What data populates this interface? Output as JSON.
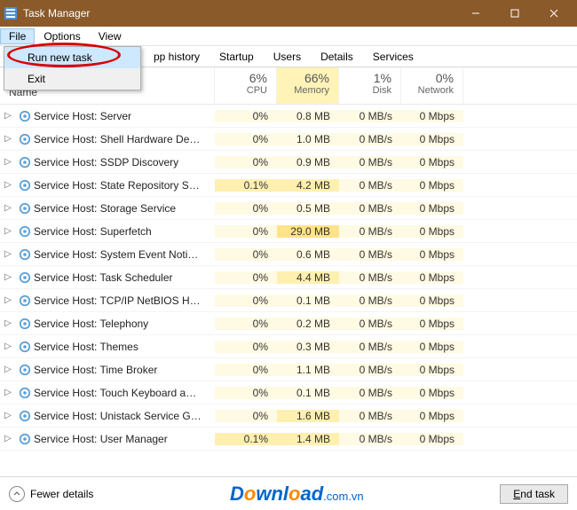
{
  "window": {
    "title": "Task Manager"
  },
  "menubar": {
    "file": "File",
    "options": "Options",
    "view": "View"
  },
  "file_menu": {
    "run_new_task": "Run new task",
    "exit": "Exit"
  },
  "tabs": {
    "app_history": "pp history",
    "startup": "Startup",
    "users": "Users",
    "details": "Details",
    "services": "Services"
  },
  "columns": {
    "name": "Name",
    "cpu_pct": "6%",
    "cpu_label": "CPU",
    "mem_pct": "66%",
    "mem_label": "Memory",
    "disk_pct": "1%",
    "disk_label": "Disk",
    "net_pct": "0%",
    "net_label": "Network"
  },
  "processes": [
    {
      "name": "Service Host: Server",
      "cpu": "0%",
      "mem": "0.8 MB",
      "disk": "0 MB/s",
      "net": "0 Mbps",
      "mem_tint": 1
    },
    {
      "name": "Service Host: Shell Hardware De…",
      "cpu": "0%",
      "mem": "1.0 MB",
      "disk": "0 MB/s",
      "net": "0 Mbps",
      "mem_tint": 1
    },
    {
      "name": "Service Host: SSDP Discovery",
      "cpu": "0%",
      "mem": "0.9 MB",
      "disk": "0 MB/s",
      "net": "0 Mbps",
      "mem_tint": 1
    },
    {
      "name": "Service Host: State Repository S…",
      "cpu": "0.1%",
      "mem": "4.2 MB",
      "disk": "0 MB/s",
      "net": "0 Mbps",
      "mem_tint": 2,
      "cpu_tint": 2
    },
    {
      "name": "Service Host: Storage Service",
      "cpu": "0%",
      "mem": "0.5 MB",
      "disk": "0 MB/s",
      "net": "0 Mbps",
      "mem_tint": 1
    },
    {
      "name": "Service Host: Superfetch",
      "cpu": "0%",
      "mem": "29.0 MB",
      "disk": "0 MB/s",
      "net": "0 Mbps",
      "mem_tint": 3
    },
    {
      "name": "Service Host: System Event Noti…",
      "cpu": "0%",
      "mem": "0.6 MB",
      "disk": "0 MB/s",
      "net": "0 Mbps",
      "mem_tint": 1
    },
    {
      "name": "Service Host: Task Scheduler",
      "cpu": "0%",
      "mem": "4.4 MB",
      "disk": "0 MB/s",
      "net": "0 Mbps",
      "mem_tint": 2
    },
    {
      "name": "Service Host: TCP/IP NetBIOS H…",
      "cpu": "0%",
      "mem": "0.1 MB",
      "disk": "0 MB/s",
      "net": "0 Mbps",
      "mem_tint": 1
    },
    {
      "name": "Service Host: Telephony",
      "cpu": "0%",
      "mem": "0.2 MB",
      "disk": "0 MB/s",
      "net": "0 Mbps",
      "mem_tint": 1
    },
    {
      "name": "Service Host: Themes",
      "cpu": "0%",
      "mem": "0.3 MB",
      "disk": "0 MB/s",
      "net": "0 Mbps",
      "mem_tint": 1
    },
    {
      "name": "Service Host: Time Broker",
      "cpu": "0%",
      "mem": "1.1 MB",
      "disk": "0 MB/s",
      "net": "0 Mbps",
      "mem_tint": 1
    },
    {
      "name": "Service Host: Touch Keyboard a…",
      "cpu": "0%",
      "mem": "0.1 MB",
      "disk": "0 MB/s",
      "net": "0 Mbps",
      "mem_tint": 1
    },
    {
      "name": "Service Host: Unistack Service G…",
      "cpu": "0%",
      "mem": "1.6 MB",
      "disk": "0 MB/s",
      "net": "0 Mbps",
      "mem_tint": 2
    },
    {
      "name": "Service Host: User Manager",
      "cpu": "0.1%",
      "mem": "1.4 MB",
      "disk": "0 MB/s",
      "net": "0 Mbps",
      "mem_tint": 2,
      "cpu_tint": 2
    }
  ],
  "footer": {
    "fewer": "Fewer details",
    "end_task": "End task",
    "watermark_main": "Download",
    "watermark_ext": ".com.vn"
  }
}
